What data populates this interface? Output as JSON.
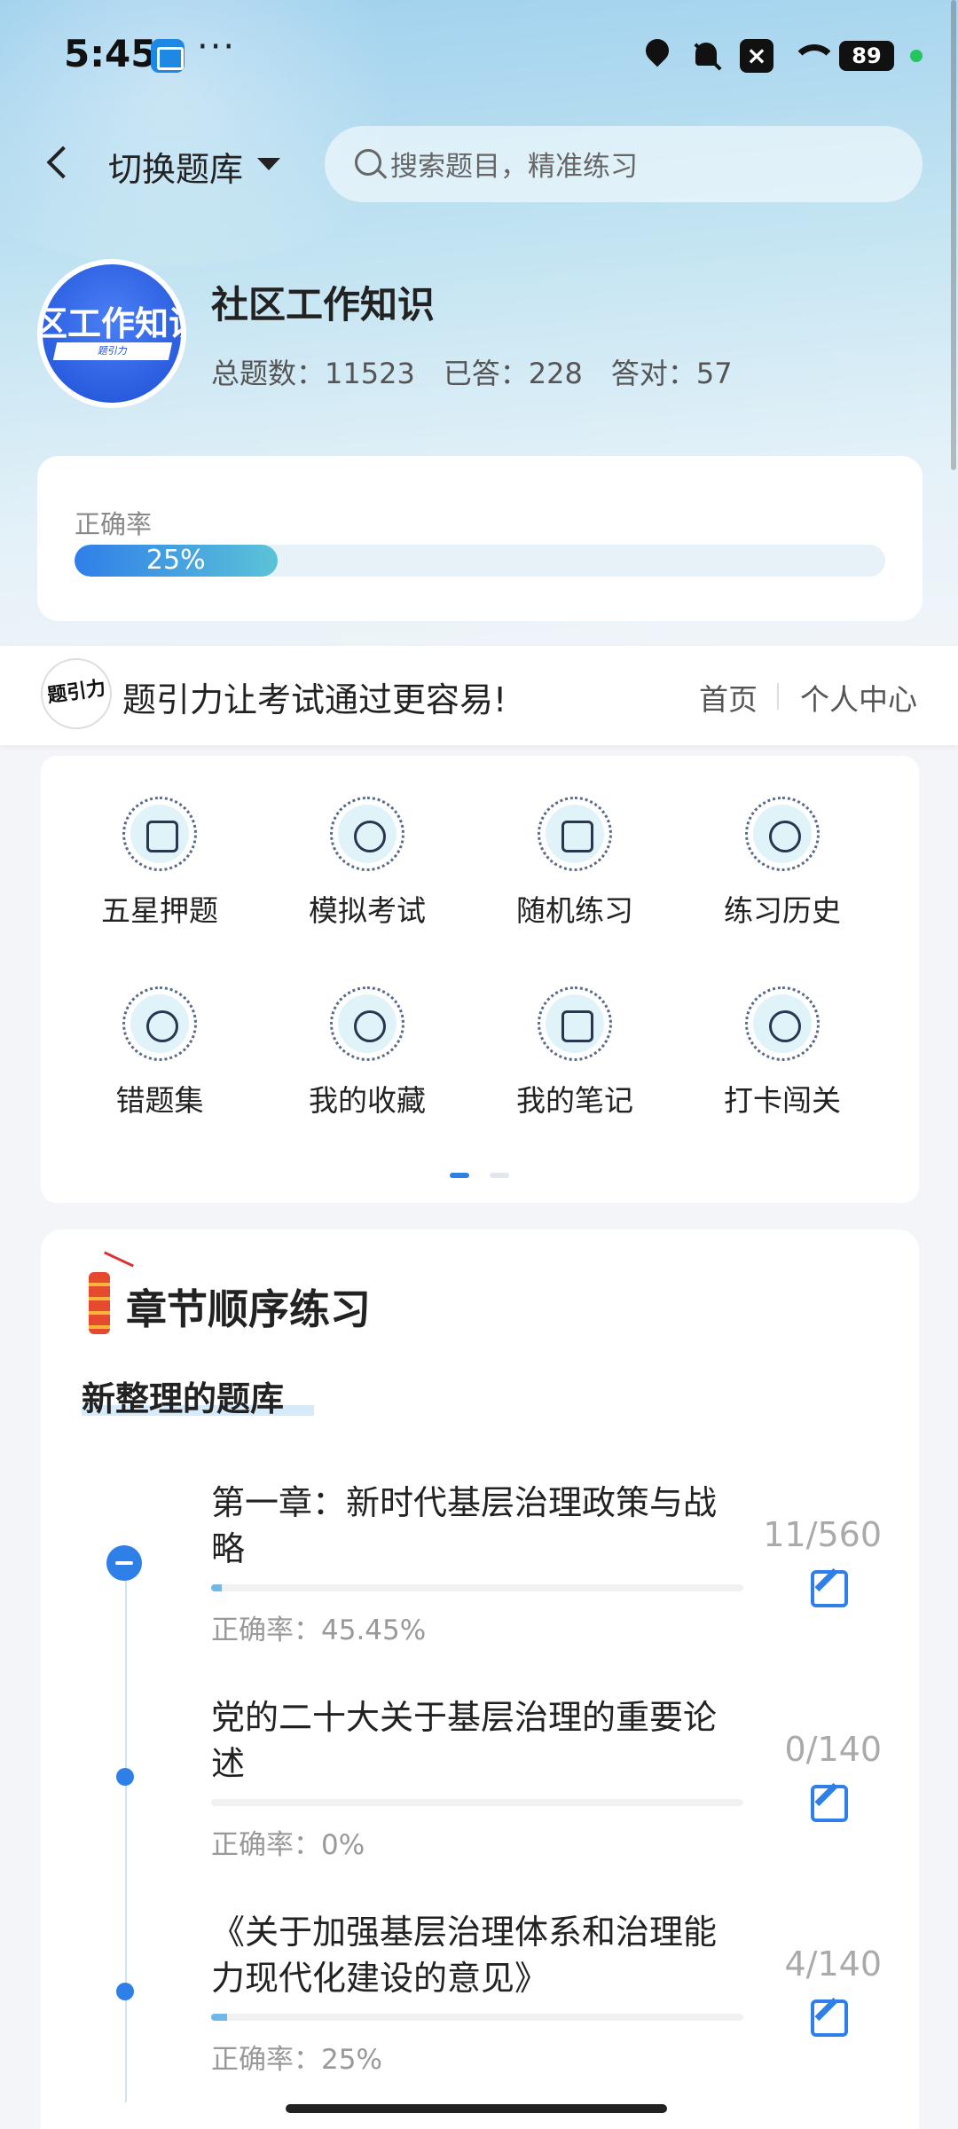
{
  "status_bar": {
    "time": "5:45",
    "battery": "89",
    "dots": "···"
  },
  "header": {
    "switch_label": "切换题库",
    "search_placeholder": "搜索题目，精准练习"
  },
  "bank": {
    "logo_text": "区工作知识",
    "logo_sub": "题引力",
    "title": "社区工作知识",
    "stats": "总题数：11523　已答：228　答对：57"
  },
  "accuracy": {
    "label": "正确率",
    "percent_text": "25%",
    "value": 0.25
  },
  "banner": {
    "slogan": "题引力让考试通过更容易!",
    "nav_home": "首页",
    "nav_user": "个人中心"
  },
  "features": [
    {
      "label": "五星押题",
      "icon": "id-card-icon"
    },
    {
      "label": "模拟考试",
      "icon": "speedometer-icon"
    },
    {
      "label": "随机练习",
      "icon": "network-icon"
    },
    {
      "label": "练习历史",
      "icon": "globe-icon"
    },
    {
      "label": "错题集",
      "icon": "head-icon"
    },
    {
      "label": "我的收藏",
      "icon": "heart-icon"
    },
    {
      "label": "我的笔记",
      "icon": "check-note-icon"
    },
    {
      "label": "打卡闯关",
      "icon": "sprout-icon"
    }
  ],
  "chapters_section": {
    "title": "章节顺序练习",
    "subtitle": "新整理的题库",
    "items": [
      {
        "name": "第一章：新时代基层治理政策与战略",
        "count": "11/560",
        "accuracy": "正确率：45.45%",
        "progress": 0.02
      },
      {
        "name": "党的二十大关于基层治理的重要论述",
        "count": "0/140",
        "accuracy": "正确率：0%",
        "progress": 0
      },
      {
        "name": "《关于加强基层治理体系和治理能力现代化建设的意见》",
        "count": "4/140",
        "accuracy": "正确率：25%",
        "progress": 0.03
      }
    ]
  },
  "colors": {
    "accent": "#2f7fe8",
    "progress_end": "#5bc3d8",
    "status_dot": "#22c55e"
  }
}
